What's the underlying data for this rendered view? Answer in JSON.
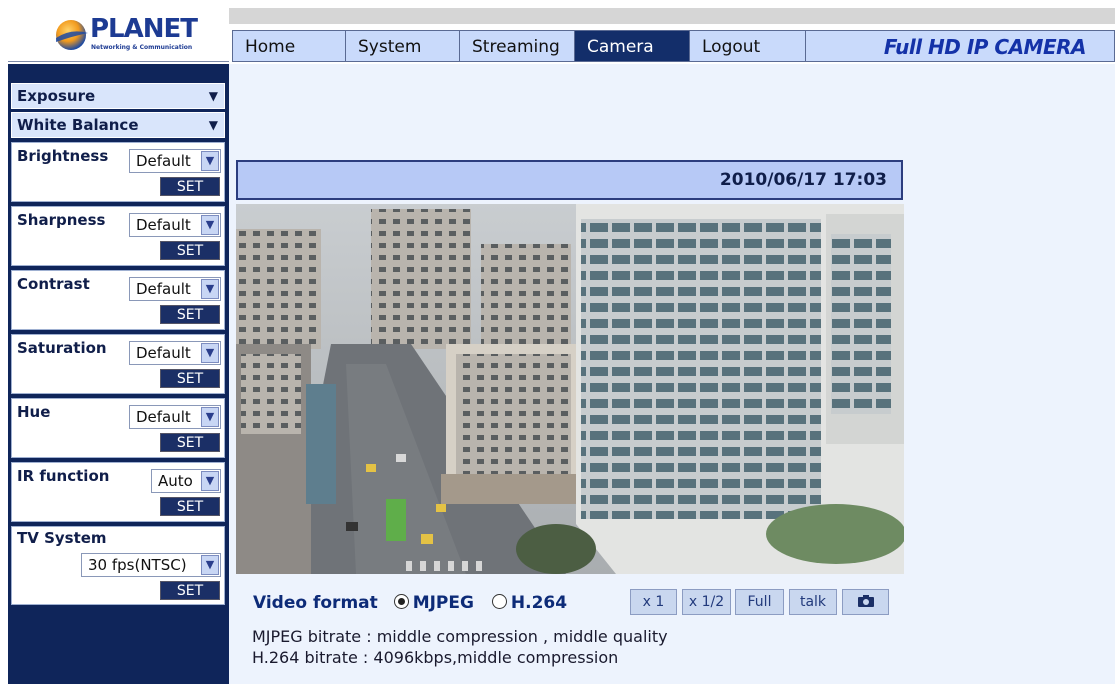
{
  "header": {
    "logo_text": "PLANET",
    "logo_subtext": "Networking & Communication",
    "brand_text": "Full HD IP CAMERA"
  },
  "nav": {
    "tabs": [
      {
        "label": "Home"
      },
      {
        "label": "System"
      },
      {
        "label": "Streaming"
      },
      {
        "label": "Camera",
        "active": true
      },
      {
        "label": "Logout"
      }
    ]
  },
  "sidebar": {
    "exposure_label": "Exposure",
    "white_balance_label": "White Balance",
    "set_label": "SET",
    "panels": [
      {
        "label": "Brightness",
        "value": "Default"
      },
      {
        "label": "Sharpness",
        "value": "Default"
      },
      {
        "label": "Contrast",
        "value": "Default"
      },
      {
        "label": "Saturation",
        "value": "Default"
      },
      {
        "label": "Hue",
        "value": "Default"
      },
      {
        "label": "IR function",
        "value": "Auto"
      },
      {
        "label": "TV System",
        "value": "30 fps(NTSC)"
      }
    ]
  },
  "video": {
    "timestamp": "2010/06/17 17:03",
    "format_label": "Video format",
    "format_options": [
      "MJPEG",
      "H.264"
    ],
    "selected_format": "MJPEG",
    "buttons": [
      "x 1",
      "x 1/2",
      "Full",
      "talk"
    ],
    "snapshot_icon": "camera-icon",
    "mjpeg_bitrate": "MJPEG bitrate : middle compression , middle quality",
    "h264_bitrate": "H.264 bitrate : 4096kbps,middle compression"
  },
  "colors": {
    "sidebar_bg": "#0f255a",
    "content_bg": "#edf3fd",
    "tab_bg": "#c9dafb",
    "tab_active_bg": "#132e6a",
    "set_button_bg": "#1b2f66"
  }
}
